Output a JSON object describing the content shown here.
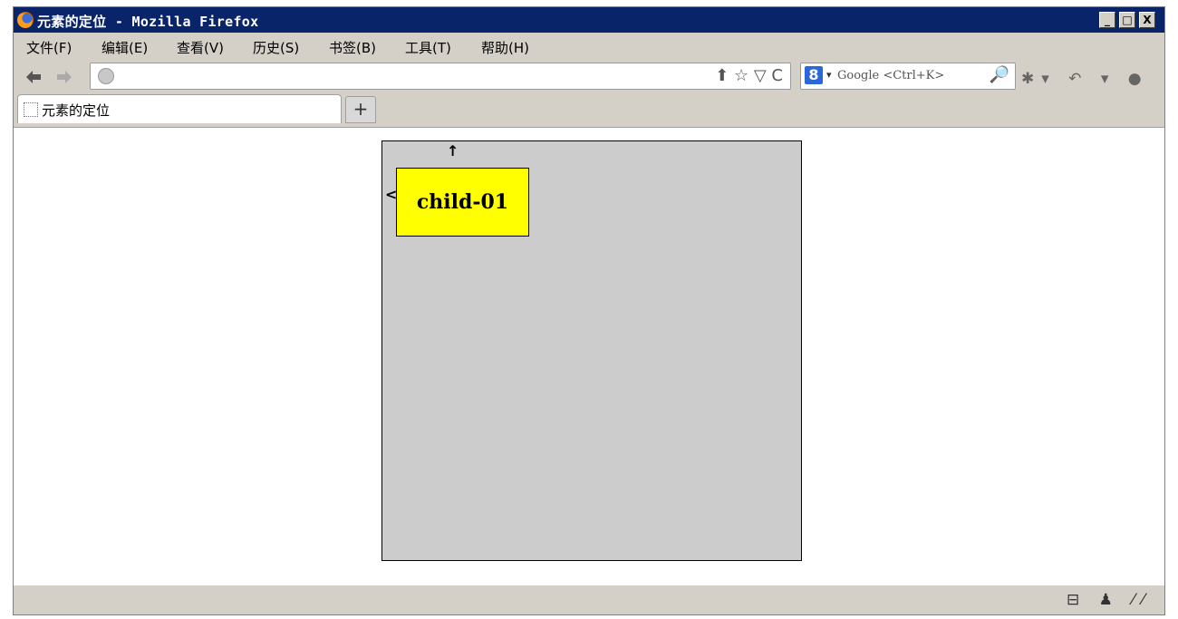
{
  "window": {
    "title": "元素的定位 - Mozilla Firefox"
  },
  "window_controls": {
    "minimize": "_",
    "maximize": "□",
    "close": "X"
  },
  "menu": {
    "items": [
      "文件(F)",
      "编辑(E)",
      "查看(V)",
      "历史(S)",
      "书签(B)",
      "工具(T)",
      "帮助(H)"
    ]
  },
  "navigation": {
    "back_icon": "back-arrow-icon",
    "forward_icon": "forward-arrow-icon",
    "url_value": "",
    "url_icons": "⬆ ☆ ▽ C"
  },
  "search": {
    "engine_icon": "8",
    "dropdown": "▾",
    "placeholder": "Google <Ctrl+K>",
    "search_icon": "🔎"
  },
  "toolbar_extra": "✱▾ ↶ ▾ ●",
  "tabs": {
    "active_label": "元素的定位",
    "new_tab_label": "+"
  },
  "page": {
    "child_label": "child-01",
    "arrow_up": "↑",
    "arrow_left": "<"
  },
  "status": {
    "icons": "⊟ ♟ ⁄⁄"
  },
  "colors": {
    "title_bar": "#0a246a",
    "parent_bg": "#cccccc",
    "child_bg": "#ffff00",
    "chrome": "#d4d0c8"
  }
}
